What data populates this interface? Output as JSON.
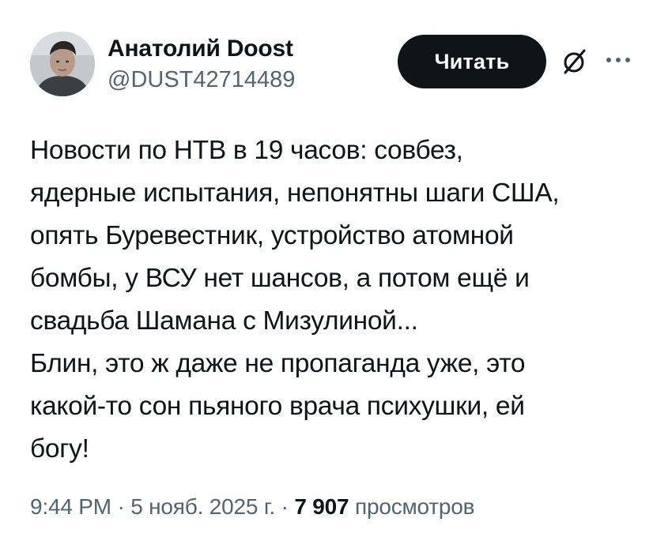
{
  "author": {
    "display_name": "Анатолий Doost",
    "handle": "@DUST42714489"
  },
  "actions": {
    "read_label": "Читать",
    "grok_icon": "slashed-circle-icon",
    "more_icon": "ellipsis-icon"
  },
  "tweet": {
    "lines": [
      "Новости по НТВ в 19 часов: совбез,",
      "ядерные испытания, непонятны шаги США,",
      "опять Буревестник, устройство атомной",
      "бомбы, у ВСУ нет шансов, а потом ещё и",
      "свадьба Шамана с Мизулиной...",
      "Блин, это ж даже не пропаганда уже, это",
      "какой-то сон пьяного врача психушки, ей",
      "богу!"
    ]
  },
  "meta": {
    "time": "9:44 PM",
    "separator": "·",
    "date": "5 нояб. 2025 г.",
    "views_count": "7 907",
    "views_label": "просмотров"
  },
  "colors": {
    "text": "#0f1419",
    "secondary": "#536471",
    "button_bg": "#0f1419",
    "button_text": "#ffffff"
  }
}
